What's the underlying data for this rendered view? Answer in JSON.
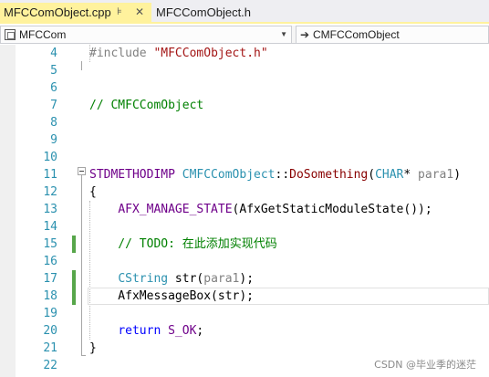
{
  "tabs": [
    {
      "label": "MFCComObject.cpp",
      "active": true,
      "pin_glyph": "⊧",
      "close_glyph": "✕"
    },
    {
      "label": "MFCComObject.h",
      "active": false
    }
  ],
  "navbar": {
    "class_scope": "MFCCom",
    "member_scope": "CMFCComObject",
    "dropdown_glyph": "▼",
    "arrow_glyph": "➔"
  },
  "colors": {
    "active_tab": "#fff29d",
    "line_number": "#2b91af",
    "keyword": "#0000ff",
    "string": "#a31515",
    "comment": "#008000",
    "macro": "#6f008a",
    "type": "#2b91af",
    "function": "#880000",
    "change_bar": "#57a64a"
  },
  "editor": {
    "line_numbers": [
      "4",
      "5",
      "6",
      "7",
      "8",
      "9",
      "10",
      "11",
      "12",
      "13",
      "14",
      "15",
      "16",
      "17",
      "18",
      "19",
      "20",
      "21",
      "22"
    ],
    "lines": [
      [
        {
          "t": "#include ",
          "c": "dir"
        },
        {
          "t": "\"MFCComObject.h\"",
          "c": "str"
        }
      ],
      [],
      [],
      [
        {
          "t": "// CMFCComObject",
          "c": "cmt"
        }
      ],
      [],
      [],
      [],
      [
        {
          "t": "STDMETHODIMP",
          "c": "macro"
        },
        {
          "t": " ",
          "c": "plain"
        },
        {
          "t": "CMFCComObject",
          "c": "type"
        },
        {
          "t": "::",
          "c": "plain"
        },
        {
          "t": "DoSomething",
          "c": "fn"
        },
        {
          "t": "(",
          "c": "plain"
        },
        {
          "t": "CHAR",
          "c": "type"
        },
        {
          "t": "* ",
          "c": "plain"
        },
        {
          "t": "para1",
          "c": "param"
        },
        {
          "t": ")",
          "c": "plain"
        }
      ],
      [
        {
          "t": "{",
          "c": "plain"
        }
      ],
      [
        {
          "t": "    ",
          "c": "plain"
        },
        {
          "t": "AFX_MANAGE_STATE",
          "c": "macro"
        },
        {
          "t": "(AfxGetStaticModuleState());",
          "c": "plain"
        }
      ],
      [],
      [
        {
          "t": "    // TODO: 在此添加实现代码",
          "c": "cmt"
        }
      ],
      [],
      [
        {
          "t": "    ",
          "c": "plain"
        },
        {
          "t": "CString",
          "c": "type"
        },
        {
          "t": " str(",
          "c": "plain"
        },
        {
          "t": "para1",
          "c": "param"
        },
        {
          "t": ");",
          "c": "plain"
        }
      ],
      [
        {
          "t": "    AfxMessageBox(str);",
          "c": "plain"
        }
      ],
      [],
      [
        {
          "t": "    ",
          "c": "plain"
        },
        {
          "t": "return",
          "c": "kw"
        },
        {
          "t": " ",
          "c": "plain"
        },
        {
          "t": "S_OK",
          "c": "macro"
        },
        {
          "t": ";",
          "c": "plain"
        }
      ],
      [
        {
          "t": "}",
          "c": "plain"
        }
      ],
      []
    ]
  },
  "watermark": "CSDN @毕业季的迷茫"
}
